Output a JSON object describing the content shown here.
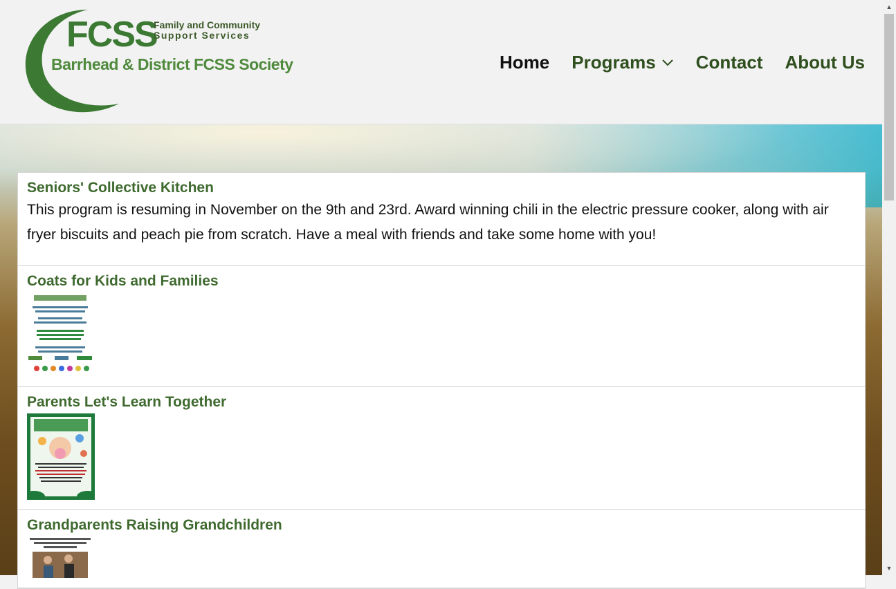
{
  "brand": {
    "fcss": "FCSS",
    "sub_line1": "Family and Community",
    "sub_line2": "Support Services",
    "society": "Barrhead & District FCSS Society",
    "green": "#3c7a34"
  },
  "nav": {
    "items": [
      {
        "label": "Home",
        "active": true
      },
      {
        "label": "Programs",
        "has_dropdown": true
      },
      {
        "label": "Contact"
      },
      {
        "label": "About Us"
      }
    ]
  },
  "programs": [
    {
      "title": "Seniors' Collective Kitchen",
      "text": "This program is resuming in November on the 9th and 23rd. Award winning chili in the electric pressure cooker, along with air fryer biscuits and peach pie from scratch. Have a meal with friends and take some home with you!"
    },
    {
      "title": "Coats for Kids and Families",
      "thumbnail": "coats-for-kids-flyer"
    },
    {
      "title": "Parents Let's Learn Together",
      "thumbnail": "new-moms-dads-flyer"
    },
    {
      "title": "Grandparents Raising Grandchildren",
      "thumbnail": "grandparents-support-group-flyer"
    }
  ],
  "colors": {
    "title_green": "#3f6a2f",
    "nav_green": "#2f4f1f"
  }
}
